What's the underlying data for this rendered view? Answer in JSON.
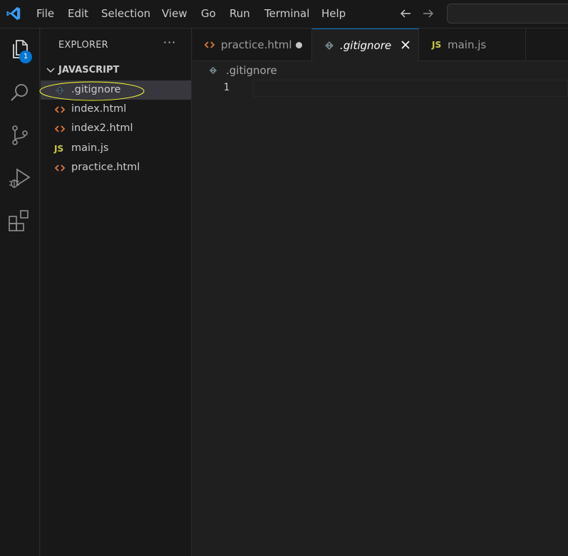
{
  "menu": [
    "File",
    "Edit",
    "Selection",
    "View",
    "Go",
    "Run",
    "Terminal",
    "Help"
  ],
  "activity": {
    "explorer_badge": "1",
    "icons": [
      "files-icon",
      "search-icon",
      "source-control-icon",
      "run-debug-icon",
      "extensions-icon"
    ]
  },
  "sidebar": {
    "title": "EXPLORER",
    "more": "···",
    "folder": "JAVASCRIPT",
    "files": [
      {
        "label": ".gitignore",
        "icon": "git-icon",
        "selected": true
      },
      {
        "label": "index.html",
        "icon": "html-icon"
      },
      {
        "label": "index2.html",
        "icon": "html-icon"
      },
      {
        "label": "main.js",
        "icon": "js-icon",
        "icon_text": "JS"
      },
      {
        "label": "practice.html",
        "icon": "html-icon"
      }
    ]
  },
  "tabs": [
    {
      "label": "practice.html",
      "icon": "html-icon",
      "modified": true
    },
    {
      "label": ".gitignore",
      "icon": "git-icon",
      "active": true
    },
    {
      "label": "main.js",
      "icon": "js-icon",
      "icon_text": "JS"
    }
  ],
  "editor": {
    "breadcrumb": ".gitignore",
    "line_number": "1"
  },
  "colors": {
    "accent": "#0078d4",
    "html_icon": "#e37933",
    "js_icon": "#cbcb41",
    "highlight": "#ffff33"
  }
}
